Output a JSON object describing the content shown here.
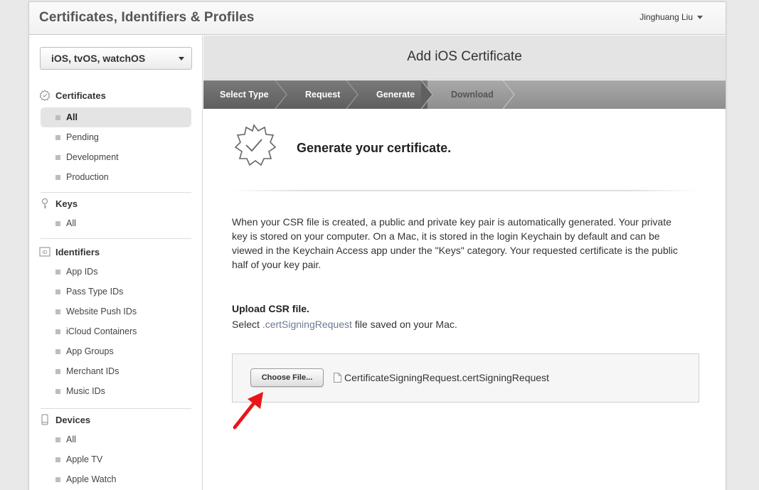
{
  "header": {
    "app_title": "Certificates, Identifiers & Profiles",
    "user": "Jinghuang Liu"
  },
  "sidebar": {
    "platform": "iOS, tvOS, watchOS",
    "sections": [
      {
        "title": "Certificates",
        "icon": "certificate-icon",
        "items": [
          "All",
          "Pending",
          "Development",
          "Production"
        ]
      },
      {
        "title": "Keys",
        "icon": "key-icon",
        "items": [
          "All"
        ]
      },
      {
        "title": "Identifiers",
        "icon": "id-icon",
        "items": [
          "App IDs",
          "Pass Type IDs",
          "Website Push IDs",
          "iCloud Containers",
          "App Groups",
          "Merchant IDs",
          "Music IDs"
        ]
      },
      {
        "title": "Devices",
        "icon": "device-icon",
        "items": [
          "All",
          "Apple TV",
          "Apple Watch"
        ]
      }
    ],
    "id_icon_text": "ID",
    "active_item": "Certificates / All"
  },
  "main": {
    "title": "Add iOS Certificate",
    "steps": [
      {
        "label": "Select Type",
        "state": "done"
      },
      {
        "label": "Request",
        "state": "done"
      },
      {
        "label": "Generate",
        "state": "current"
      },
      {
        "label": "Download",
        "state": "todo"
      }
    ],
    "gen_title": "Generate your certificate.",
    "description": "When your CSR file is created, a public and private key pair is automatically generated. Your private key is stored on your computer. On a Mac, it is stored in the login Keychain by default and can be viewed in the Keychain Access app under the \"Keys\" category. Your requested certificate is the public half of your key pair.",
    "upload_title": "Upload CSR file.",
    "upload_prefix": "Select ",
    "upload_ext": ".certSigningRequest",
    "upload_suffix": " file saved on your Mac.",
    "choose_label": "Choose File...",
    "file_name": "CertificateSigningRequest.certSigningRequest"
  },
  "colors": {
    "arrow": "#e8161b",
    "steps_done": "#6a6a6a",
    "steps_todo": "#9b9b9b"
  }
}
